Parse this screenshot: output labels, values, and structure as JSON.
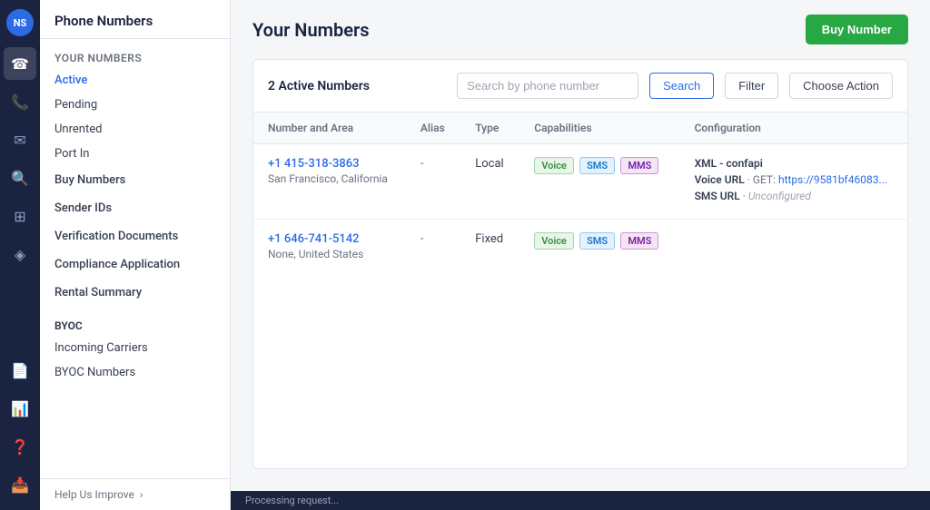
{
  "iconBar": {
    "logo": "NS",
    "icons": [
      {
        "name": "phone-icon",
        "symbol": "📞",
        "active": true
      },
      {
        "name": "call-icon",
        "symbol": "📱",
        "active": false
      },
      {
        "name": "message-icon",
        "symbol": "💬",
        "active": false
      },
      {
        "name": "search-icon",
        "symbol": "🔍",
        "active": false
      },
      {
        "name": "grid-icon",
        "symbol": "⊞",
        "active": false
      },
      {
        "name": "cursor-icon",
        "symbol": "⬡",
        "active": false
      },
      {
        "name": "docs-icon",
        "symbol": "📄",
        "active": false
      },
      {
        "name": "chart-icon",
        "symbol": "📊",
        "active": false
      },
      {
        "name": "question-icon",
        "symbol": "❓",
        "active": false
      },
      {
        "name": "inbox-icon",
        "symbol": "📥",
        "active": false
      }
    ]
  },
  "sidebar": {
    "header": "Phone Numbers",
    "yourNumbers": {
      "sectionLabel": "Your Numbers",
      "items": [
        {
          "label": "Active",
          "active": true
        },
        {
          "label": "Pending",
          "active": false
        },
        {
          "label": "Unrented",
          "active": false
        },
        {
          "label": "Port In",
          "active": false
        }
      ]
    },
    "buyNumbers": {
      "label": "Buy Numbers"
    },
    "senderIds": {
      "label": "Sender IDs"
    },
    "verificationDocuments": {
      "label": "Verification Documents"
    },
    "complianceApplication": {
      "label": "Compliance Application"
    },
    "rentalSummary": {
      "label": "Rental Summary"
    },
    "byoc": {
      "sectionLabel": "BYOC",
      "items": [
        {
          "label": "Incoming Carriers"
        },
        {
          "label": "BYOC Numbers"
        }
      ]
    },
    "footer": {
      "helpLabel": "Help Us Improve"
    }
  },
  "main": {
    "pageTitle": "Your Numbers",
    "buyButton": "Buy Number",
    "activeCount": "2 Active Numbers",
    "searchPlaceholder": "Search by phone number",
    "searchButton": "Search",
    "filterButton": "Filter",
    "chooseActionButton": "Choose Action",
    "table": {
      "headers": [
        "Number and Area",
        "Alias",
        "Type",
        "Capabilities",
        "Configuration"
      ],
      "rows": [
        {
          "number": "+1 415-318-3863",
          "location": "San Francisco, California",
          "alias": "-",
          "type": "Local",
          "capabilities": [
            "Voice",
            "SMS",
            "MMS"
          ],
          "configuration": {
            "xmlLabel": "XML - confapi",
            "voiceUrlLabel": "Voice URL",
            "voiceUrlMethod": "GET:",
            "voiceUrlValue": "https://9581bf46083...",
            "smsUrlLabel": "SMS URL",
            "smsUrlValue": "Unconfigured"
          }
        },
        {
          "number": "+1 646-741-5142",
          "location": "None, United States",
          "alias": "-",
          "type": "Fixed",
          "capabilities": [
            "Voice",
            "SMS",
            "MMS"
          ],
          "configuration": null
        }
      ]
    }
  },
  "statusBar": {
    "text": "Processing request..."
  }
}
